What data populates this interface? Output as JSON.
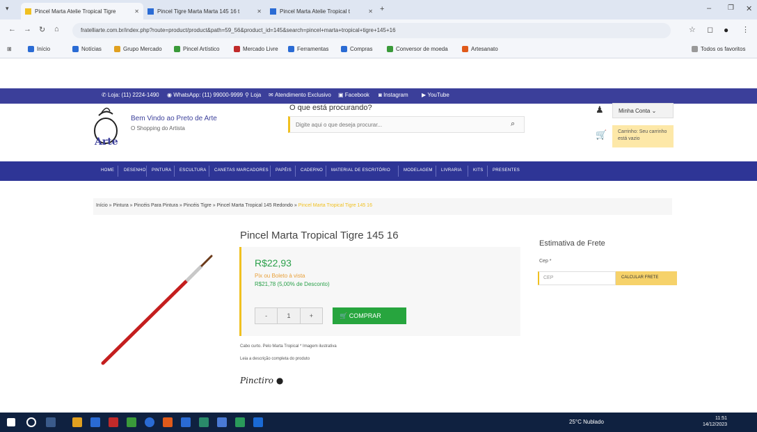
{
  "browser": {
    "tabs": [
      {
        "label": "Pincel Marta Atelie Tropical Tigre"
      },
      {
        "label": "Pincel Tigre Marta Marta 145 16 t"
      },
      {
        "label": "Pincel Marta Atelie Tropical t"
      }
    ],
    "new_tab": "+",
    "url": "fratelliarte.com.br/index.php?route=product/product&path=59_56&product_id=145&search=pincel+marta+tropical+tigre+145+16",
    "bookmarks": [
      {
        "label": "Início",
        "color": "#2a6bd4"
      },
      {
        "label": "Notícias",
        "color": "#2a6bd4"
      },
      {
        "label": "Grupo Mercado",
        "color": "#e0a020"
      },
      {
        "label": "Pincel Artístico",
        "color": "#3a9a3a"
      },
      {
        "label": "Mercado Livre",
        "color": "#c02a2a"
      },
      {
        "label": "Ferramentas",
        "color": "#2a6bd4"
      },
      {
        "label": "Compras",
        "color": "#2a6bd4"
      },
      {
        "label": "Conversor de moeda",
        "color": "#3a9a3a"
      },
      {
        "label": "Artesanato",
        "color": "#e05a1a"
      },
      {
        "label": "Todos os favoritos",
        "color": "#999999"
      }
    ]
  },
  "site": {
    "contacts": [
      {
        "icon": "phone-icon",
        "label": "Loja: (11) 2224-1490"
      },
      {
        "icon": "whatsapp-icon",
        "label": "WhatsApp: (11) 99000-9999"
      },
      {
        "icon": "location-icon",
        "label": "Loja"
      },
      {
        "icon": "mail-icon",
        "label": "Atendimento Exclusivo"
      },
      {
        "icon": "facebook-icon",
        "label": "Facebook"
      },
      {
        "icon": "instagram-icon",
        "label": "Instagram"
      },
      {
        "icon": "youtube-icon",
        "label": "YouTube"
      }
    ],
    "logo_text": "Arte",
    "welcome": "Bem Vindo ao Preto de Arte",
    "welcome_sub": "O Shopping do Artista",
    "search_label": "O que está procurando?",
    "search_placeholder": "Digite aqui o que deseja procurar...",
    "login_label": "Minha Conta",
    "cart_label": "Carrinho: Seu carrinho está vazio",
    "menu": [
      "HOME",
      "DESENHO",
      "PINTURA",
      "ESCULTURA",
      "CANETAS MARCADORES",
      "PAPÉIS",
      "CADERNO",
      "MATERIAL DE ESCRITÓRIO",
      "MODELAGEM",
      "LIVRARIA",
      "KITS",
      "PRESENTES"
    ],
    "breadcrumb": [
      "Início",
      "Pintura",
      "Pincéis Para Pintura",
      "Pincéis Tigre",
      "Pincel Marta Tropical 145 Redondo"
    ],
    "breadcrumb_current": "Pincel Marta Tropical Tigre 145 16",
    "product": {
      "title": "Pincel Marta Tropical Tigre 145 16",
      "price": "R$22,93",
      "boleto_label": "Pix ou Boleto à vista",
      "boleto_price": "R$21,78 (5,00% de Desconto)",
      "qty_minus": "-",
      "qty_value": "1",
      "qty_plus": "+",
      "buy_label": "COMPRAR",
      "note1": "Cabo curto. Pelo Marta Tropical * Imagem ilustrativa",
      "note2": "Leia a descrição completa do produto",
      "brand": "Pinctiro"
    },
    "shipping": {
      "title": "Estimativa de Frete",
      "cep_label": "Cep *",
      "cep_placeholder": "CEP",
      "calc_label": "CALCULAR FRETE"
    }
  },
  "taskbar": {
    "tray": "25°C Nublado",
    "time": "11:51",
    "date": "14/12/2023"
  },
  "colors": {
    "nav": "#2e3596",
    "accent": "#f0c020",
    "price": "#2aa04a",
    "buy": "#27a53e"
  }
}
